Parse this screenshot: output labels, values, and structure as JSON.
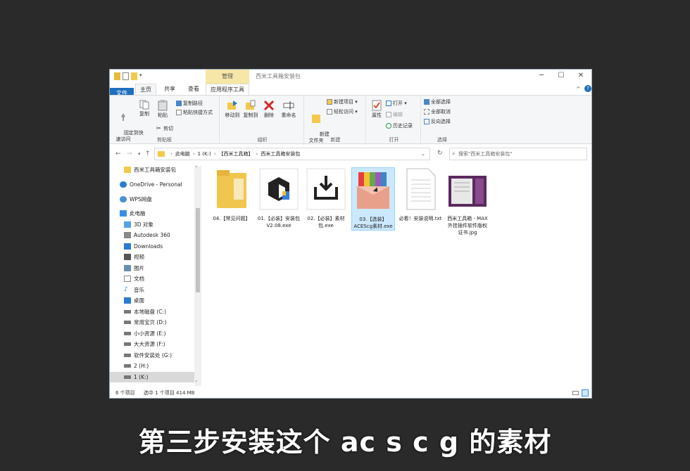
{
  "window": {
    "manage_tab": "管理",
    "title": "西米工具箱安装包",
    "minimize": "─",
    "maximize": "☐",
    "close": "✕"
  },
  "tabs": {
    "file": "文件",
    "home": "主页",
    "share": "共享",
    "view": "查看",
    "app_tools": "应用程序工具"
  },
  "ribbon": {
    "clipboard": {
      "group": "剪贴板",
      "pin": "固定到快\n速访问",
      "copy": "复制",
      "paste": "粘贴",
      "copy_path": "复制路径",
      "paste_shortcut": "粘贴快捷方式",
      "cut": "剪切"
    },
    "organize": {
      "group": "组织",
      "move_to": "移动到",
      "copy_to": "复制到",
      "delete": "删除",
      "rename": "重命名"
    },
    "new": {
      "group": "新建",
      "new_folder": "新建\n文件夹",
      "new_item": "新建项目 ▾",
      "easy_access": "轻松访问 ▾"
    },
    "open": {
      "group": "打开",
      "properties": "属性",
      "open": "打开 ▾",
      "edit": "编辑",
      "history": "历史记录"
    },
    "select": {
      "group": "选择",
      "select_all": "全部选择",
      "select_none": "全部取消",
      "invert": "反向选择"
    }
  },
  "address": {
    "crumbs": [
      "此电脑",
      "1 (K:)",
      "【西米工具箱】",
      "西米工具箱安装包"
    ],
    "search_placeholder": "搜索\"西米工具箱安装包\""
  },
  "nav_items": [
    "西米工具箱安装包",
    "OneDrive - Personal",
    "WPS网盘",
    "此电脑",
    "3D 对象",
    "Autodesk 360",
    "Downloads",
    "视频",
    "图片",
    "文档",
    "音乐",
    "桌面",
    "本地磁盘 (C:)",
    "常用宝贝 (D:)",
    "小小资源 (E:)",
    "大大资源 (F:)",
    "软件安装处 (G:)",
    "2 (H:)",
    "1 (K:)"
  ],
  "files": [
    {
      "name": "04.【常见问题】"
    },
    {
      "name": "01.【必装】安装包V2.08.exe"
    },
    {
      "name": "02.【必装】素材包.exe"
    },
    {
      "name": "03.【选装】ACEScg素材.exe"
    },
    {
      "name": "必看！安装说明.txt"
    },
    {
      "name": "西米工具箱 - MAX外挂插件软件版权证书.jpg"
    }
  ],
  "status": {
    "count": "6 个项目",
    "selected": "选中 1 个项目 414 MB"
  },
  "subtitle": "第三步安装这个 ac s c g 的素材",
  "colors": {
    "accent": "#1f6fbf",
    "manage_tab": "#f6e6a7",
    "selection": "#cce8ff"
  }
}
